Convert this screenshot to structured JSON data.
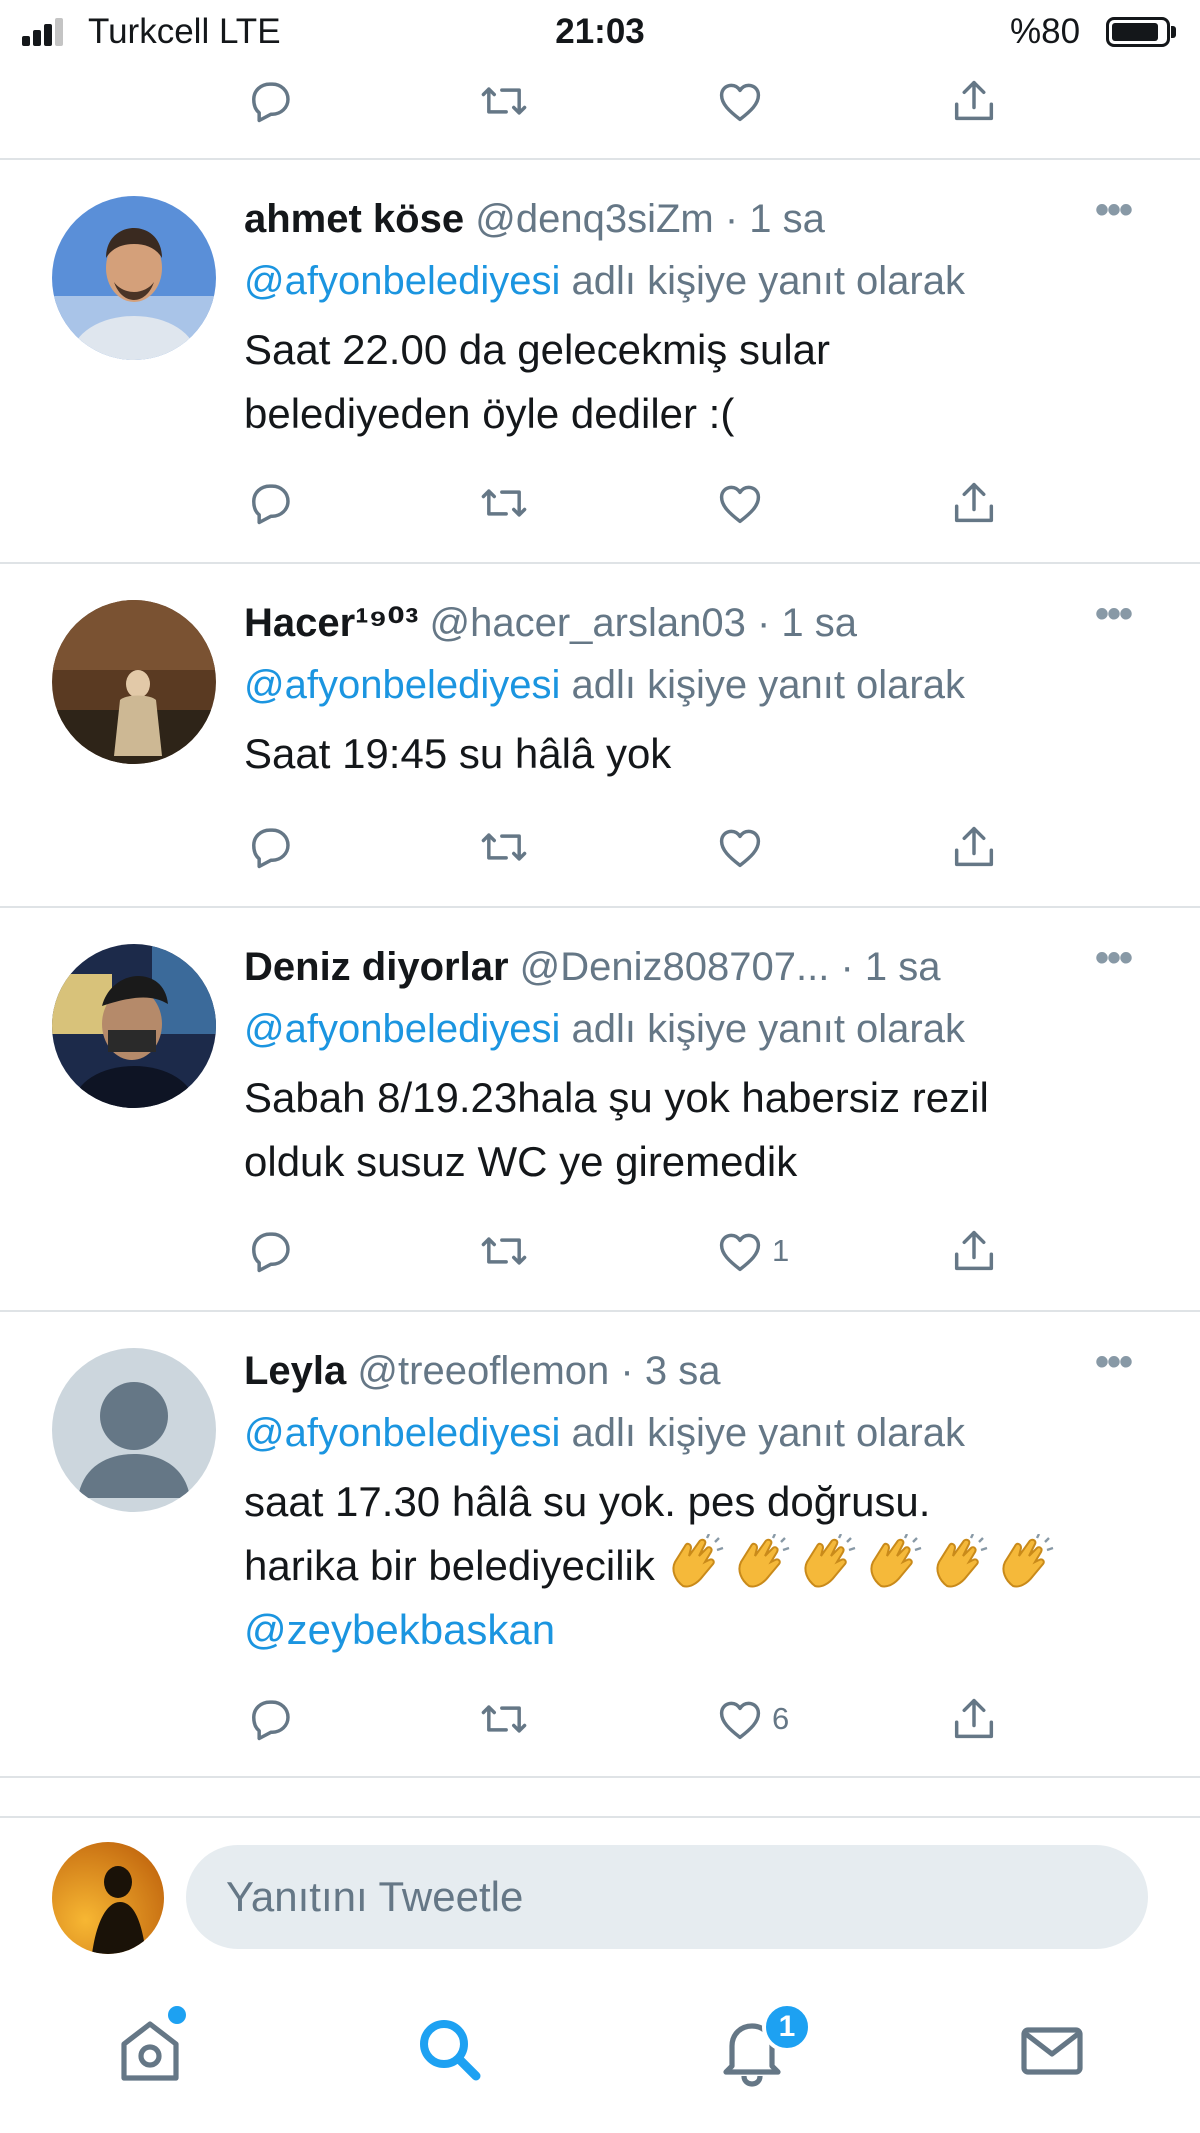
{
  "status_bar": {
    "carrier": "Turkcell  LTE",
    "time": "21:03",
    "battery": "%80",
    "battery_level": 0.8
  },
  "tweets": [
    {
      "name": "ahmet köse",
      "handle": "@denq3siZm",
      "dot": "·",
      "time": "1 sa",
      "reply_mention": "@afyonbelediyesi",
      "reply_suffix": " adlı kişiye yanıt olarak",
      "text_lines": [
        "Saat 22.00 da gelecekmiş sular",
        "belediyeden öyle dediler :("
      ],
      "like_count": ""
    },
    {
      "name": "Hacer¹⁹⁰³",
      "handle": "@hacer_arslan03",
      "dot": "·",
      "time": "1 sa",
      "reply_mention": "@afyonbelediyesi",
      "reply_suffix": " adlı kişiye yanıt olarak",
      "text_lines": [
        "Saat 19:45 su hâlâ yok"
      ],
      "like_count": ""
    },
    {
      "name": "Deniz diyorlar",
      "handle": "@Deniz808707...",
      "dot": "·",
      "time": "1 sa",
      "reply_mention": "@afyonbelediyesi",
      "reply_suffix": " adlı kişiye yanıt olarak",
      "text_lines": [
        "Sabah 8/19.23hala şu yok habersiz rezil",
        "olduk susuz WC ye giremedik"
      ],
      "like_count": "1"
    },
    {
      "name": "Leyla",
      "handle": "@treeoflemon",
      "dot": "·",
      "time": "3 sa",
      "reply_mention": "@afyonbelediyesi",
      "reply_suffix": " adlı kişiye yanıt olarak",
      "text_lines": [
        "saat 17.30 hâlâ su yok. pes doğrusu.",
        "harika bir belediyecilik "
      ],
      "text_mention": "@zeybekbaskan",
      "emoji": "clapping-hands x6",
      "like_count": "6"
    }
  ],
  "more_icon": "more-dots-icon",
  "composer": {
    "placeholder": "Yanıtını Tweetle"
  },
  "tab_bar": {
    "items": [
      "home-icon",
      "search-icon",
      "notifications-icon",
      "messages-icon"
    ],
    "notification_badge": "1"
  },
  "colors": {
    "accent": "#1da1f2",
    "link": "#1b95e0",
    "secondary_text": "#657786"
  }
}
